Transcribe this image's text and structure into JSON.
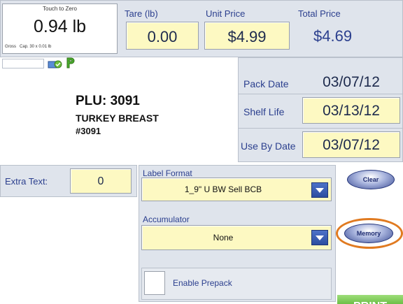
{
  "scale": {
    "zero_label": "Touch to Zero",
    "weight": "0.94 lb",
    "gross_label": "Gross",
    "capacity": "Cap. 30 x 0.01 lb"
  },
  "tare": {
    "label": "Tare (lb)",
    "value": "0.00"
  },
  "unit_price": {
    "label": "Unit Price",
    "value": "$4.99"
  },
  "total_price": {
    "label": "Total Price",
    "value": "$4.69"
  },
  "product": {
    "plu": "PLU: 3091",
    "name": "TURKEY BREAST",
    "number": "#3091"
  },
  "dates": {
    "pack_label": "Pack Date",
    "pack_value": "03/07/12",
    "shelf_label": "Shelf Life",
    "shelf_value": "03/13/12",
    "useby_label": "Use By Date",
    "useby_value": "03/07/12"
  },
  "extra_text": {
    "label": "Extra Text:",
    "value": "0"
  },
  "label_format": {
    "label": "Label Format",
    "value": "1_9\" U BW Sell BCB"
  },
  "accumulator": {
    "label": "Accumulator",
    "value": "None"
  },
  "prepack": {
    "label": "Enable Prepack"
  },
  "buttons": {
    "clear": "Clear",
    "memory": "Memory",
    "print": "PRINT"
  },
  "icons": [
    "scale-status-icon",
    "prepack-p-icon"
  ],
  "colors": {
    "field": "#fdf9c2",
    "panel": "#dfe4ec",
    "label": "#2b3f8e",
    "print": "#7fc85a",
    "highlight": "#e07a20"
  }
}
